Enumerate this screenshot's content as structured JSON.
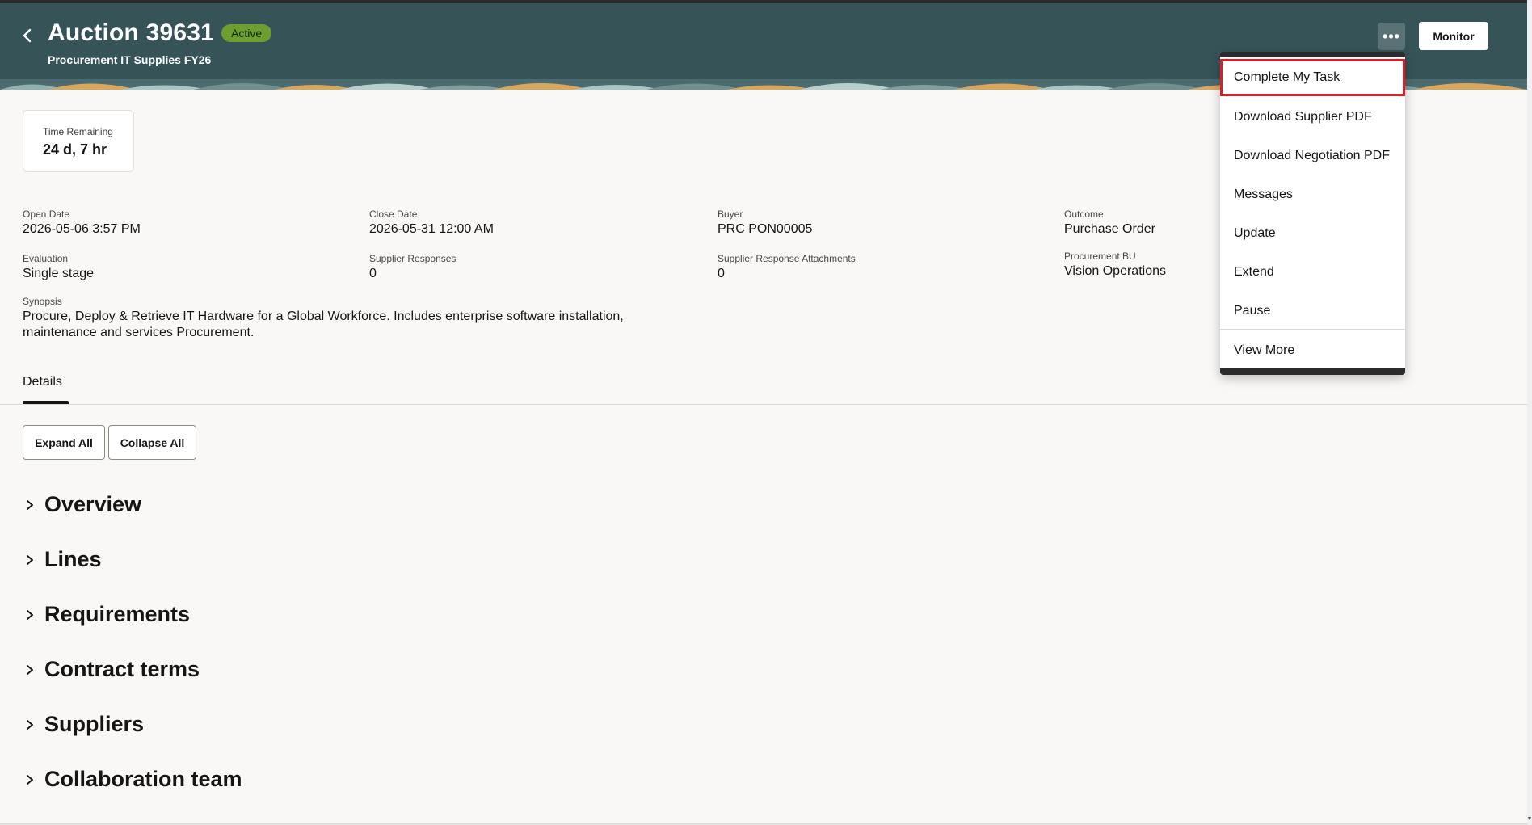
{
  "header": {
    "title": "Auction 39631",
    "status_badge": "Active",
    "subtitle": "Procurement IT Supplies FY26",
    "monitor_label": "Monitor",
    "more_label": "•••",
    "colors": {
      "background": "#365458",
      "badge": "#6e9e2f"
    }
  },
  "time_remaining": {
    "label": "Time Remaining",
    "value": "24 d, 7 hr"
  },
  "details": {
    "open_date": {
      "label": "Open Date",
      "value": "2026-05-06 3:57 PM"
    },
    "close_date": {
      "label": "Close Date",
      "value": "2026-05-31 12:00 AM"
    },
    "buyer": {
      "label": "Buyer",
      "value": "PRC PON00005"
    },
    "outcome": {
      "label": "Outcome",
      "value": "Purchase Order"
    },
    "evaluation": {
      "label": "Evaluation",
      "value": "Single stage"
    },
    "supplier_responses": {
      "label": "Supplier Responses",
      "value": "0"
    },
    "supplier_response_attachments": {
      "label": "Supplier Response Attachments",
      "value": "0"
    },
    "procurement_bu": {
      "label": "Procurement BU",
      "value": "Vision Operations"
    },
    "synopsis": {
      "label": "Synopsis",
      "value": "Procure, Deploy & Retrieve IT Hardware for a Global Workforce. Includes enterprise software installation, maintenance and services Procurement."
    }
  },
  "tabs": [
    {
      "label": "Details",
      "selected": true
    }
  ],
  "buttons": {
    "expand_all": "Expand All",
    "collapse_all": "Collapse All"
  },
  "sections": [
    "Overview",
    "Lines",
    "Requirements",
    "Contract terms",
    "Suppliers",
    "Collaboration team"
  ],
  "menu": {
    "items": [
      "Complete My Task",
      "Download Supplier PDF",
      "Download Negotiation PDF",
      "Messages",
      "Update",
      "Extend",
      "Pause",
      "View More"
    ],
    "highlighted": "Complete My Task",
    "highlight_color": "#d91f2a"
  }
}
